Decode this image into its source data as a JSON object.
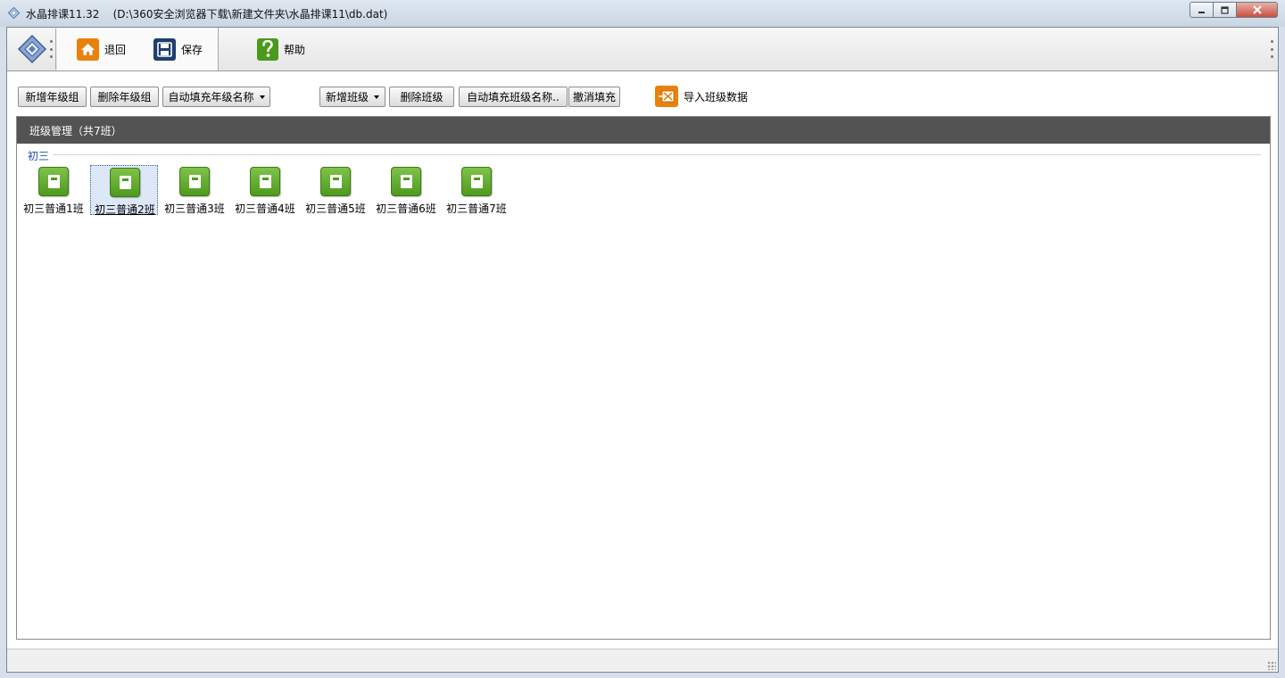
{
  "window": {
    "app_name": "水晶排课11.32",
    "file_path": "(D:\\360安全浏览器下载\\新建文件夹\\水晶排课11\\db.dat)",
    "minimize_icon": "minimize-icon",
    "maximize_icon": "maximize-icon",
    "close_icon": "close-icon"
  },
  "toolbar": {
    "back_label": "退回",
    "save_label": "保存",
    "help_label": "帮助",
    "back_icon_color": "#e8820c",
    "save_icon_color": "#1f3f6e",
    "help_icon_color": "#4a9a1c"
  },
  "actions": {
    "add_grade_group": "新增年级组",
    "delete_grade_group": "删除年级组",
    "autofill_grade_name": "自动填充年级名称",
    "add_class": "新增班级",
    "delete_class": "删除班级",
    "autofill_class_name": "自动填充班级名称..",
    "cancel_fill": "撤消填充",
    "import_class_data": "导入班级数据"
  },
  "panel": {
    "title": "班级管理（共7班）",
    "grade_group": "初三",
    "classes": [
      {
        "name": "初三普通1班",
        "selected": false
      },
      {
        "name": "初三普通2班",
        "selected": true
      },
      {
        "name": "初三普通3班",
        "selected": false
      },
      {
        "name": "初三普通4班",
        "selected": false
      },
      {
        "name": "初三普通5班",
        "selected": false
      },
      {
        "name": "初三普通6班",
        "selected": false
      },
      {
        "name": "初三普通7班",
        "selected": false
      }
    ]
  },
  "colors": {
    "panel_header": "#535353",
    "class_icon_green": "#4e9a1e",
    "group_label": "#1f4fa8"
  }
}
